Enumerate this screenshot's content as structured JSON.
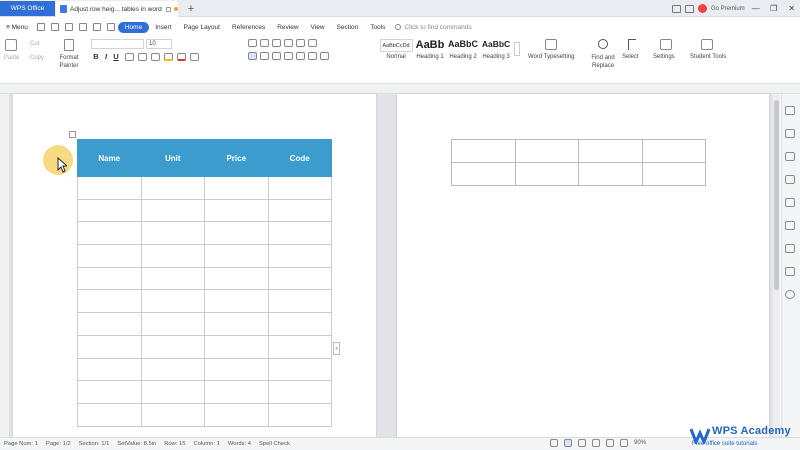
{
  "tabs": {
    "app": "WPS Office",
    "document": "Adjust row heig... tables in word",
    "new_tab": "+"
  },
  "titlebar": {
    "premium": "Go Premium",
    "avatar": "",
    "minimize": "—",
    "restore": "❐",
    "close": "✕"
  },
  "menu": {
    "menu_label": "≡ Menu",
    "items": [
      "Home",
      "Insert",
      "Page Layout",
      "References",
      "Review",
      "View",
      "Section",
      "Tools"
    ],
    "active": "Home",
    "find_placeholder": "Click to find commands"
  },
  "ribbon": {
    "paste": "Paste",
    "cut": "Cut",
    "copy": "Copy",
    "format_painter": "Format Painter",
    "font_name": "",
    "font_size": "10",
    "bold": "B",
    "italic": "I",
    "underline": "U",
    "styles": [
      {
        "preview": "AaBbCcDd",
        "name": "Normal"
      },
      {
        "preview": "AaBb",
        "name": "Heading 1"
      },
      {
        "preview": "AaBbC",
        "name": "Heading 2"
      },
      {
        "preview": "AaBbC",
        "name": "Heading 3"
      }
    ],
    "word_typesetting": "Word Typesetting",
    "find_replace": "Find and Replace",
    "select": "Select",
    "settings": "Settings",
    "student_tools": "Student Tools"
  },
  "table1": {
    "headers": [
      "Name",
      "Unit",
      "Price",
      "Code"
    ],
    "body_rows": 11,
    "header_color": "#3c9ccd"
  },
  "table2": {
    "rows": 2,
    "cols": 4
  },
  "status": {
    "page_num": "Page Num: 1",
    "page": "Page: 1/2",
    "section": "Section: 1/1",
    "set_value": "SetValue: 8.5in",
    "row": "Row: 15",
    "column": "Column: 1",
    "words": "Words: 4",
    "spell_check": "Spell Check",
    "zoom": "90%"
  },
  "watermark": {
    "title": "WPS Academy",
    "subtitle": "Free office suite tutorials"
  },
  "colors": {
    "accent": "#2f6fd7",
    "table_header": "#3c9ccd",
    "cursor_highlight": "#f7cb50"
  }
}
